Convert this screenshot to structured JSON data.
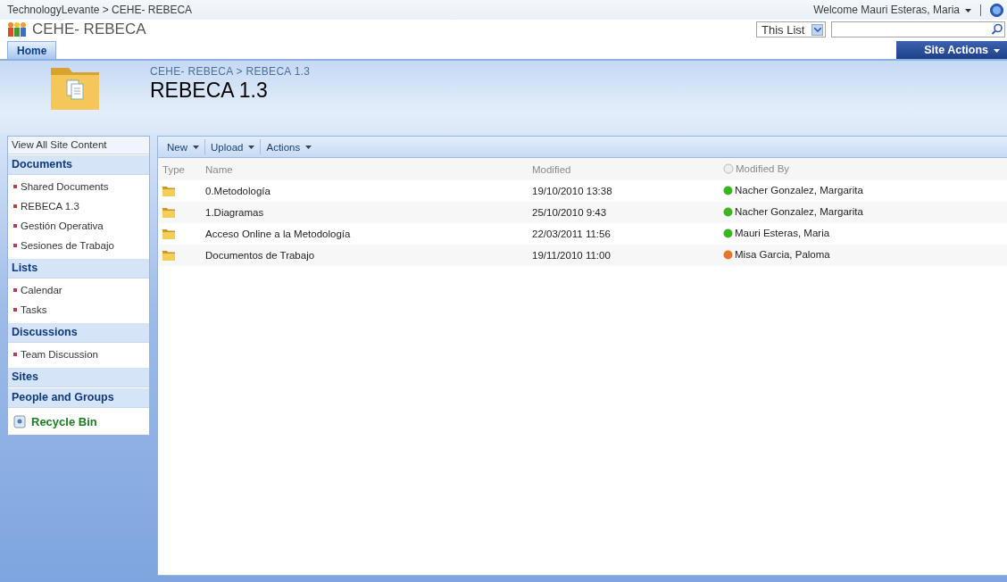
{
  "top_bar": {
    "breadcrumb": "TechnologyLevante > CEHE- REBECA",
    "welcome": "Welcome Mauri Esteras, Maria"
  },
  "site": {
    "title": "CEHE- REBECA",
    "search_scope": "This List"
  },
  "tabs": [
    {
      "label": "Home",
      "selected": true
    }
  ],
  "site_actions": "Site Actions",
  "page": {
    "breadcrumb": "CEHE- REBECA > REBECA 1.3",
    "title": "REBECA 1.3"
  },
  "sidebar": {
    "view_all": "View All Site Content",
    "sections": [
      {
        "heading": "Documents",
        "items": [
          "Shared Documents",
          "REBECA 1.3",
          "Gestión Operativa",
          "Sesiones de Trabajo"
        ]
      },
      {
        "heading": "Lists",
        "items": [
          "Calendar",
          "Tasks"
        ]
      },
      {
        "heading": "Discussions",
        "items": [
          "Team Discussion"
        ]
      },
      {
        "heading": "Sites"
      },
      {
        "heading": "People and Groups"
      }
    ],
    "recycle_bin": "Recycle Bin"
  },
  "toolbar": [
    "New",
    "Upload",
    "Actions"
  ],
  "table": {
    "columns": [
      "Type",
      "Name",
      "Modified",
      "Modified By"
    ],
    "rows": [
      {
        "name": "0.Metodología",
        "modified": "19/10/2010 13:38",
        "modified_by": "Nacher Gonzalez, Margarita",
        "color": "#3cb521"
      },
      {
        "name": "1.Diagramas",
        "modified": "25/10/2010 9:43",
        "modified_by": "Nacher Gonzalez, Margarita",
        "color": "#3cb521"
      },
      {
        "name": "Acceso Online a la Metodología",
        "modified": "22/03/2011 11:56",
        "modified_by": "Mauri Esteras, Maria",
        "color": "#3cb521"
      },
      {
        "name": "Documentos de Trabajo",
        "modified": "19/11/2010 11:00",
        "modified_by": "Misa Garcia, Paloma",
        "color": "#e8742a"
      }
    ]
  }
}
